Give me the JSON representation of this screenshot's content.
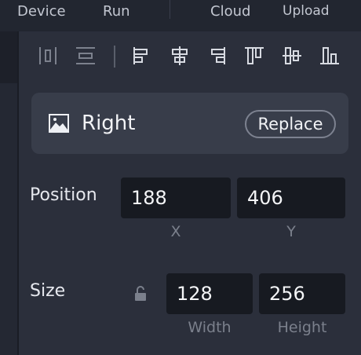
{
  "topbar": {
    "tabs": [
      "Device",
      "Run",
      "Cloud",
      "Upload"
    ]
  },
  "toolbar": {
    "tools": [
      "distribute-horizontal-icon",
      "distribute-vertical-icon",
      "align-left-icon",
      "align-center-horizontal-icon",
      "align-right-icon",
      "align-top-icon",
      "align-middle-vertical-icon",
      "align-bottom-icon"
    ]
  },
  "asset": {
    "icon": "image-icon",
    "name": "Right",
    "replace_label": "Replace"
  },
  "position": {
    "label": "Position",
    "x": "188",
    "y": "406",
    "x_label": "X",
    "y_label": "Y"
  },
  "size": {
    "label": "Size",
    "lock_icon": "unlock-icon",
    "width": "128",
    "height": "256",
    "width_label": "Width",
    "height_label": "Height"
  },
  "colors": {
    "background": "#2b2f3b",
    "card": "#383d4a",
    "field": "#171a21",
    "muted": "#7b808c"
  }
}
